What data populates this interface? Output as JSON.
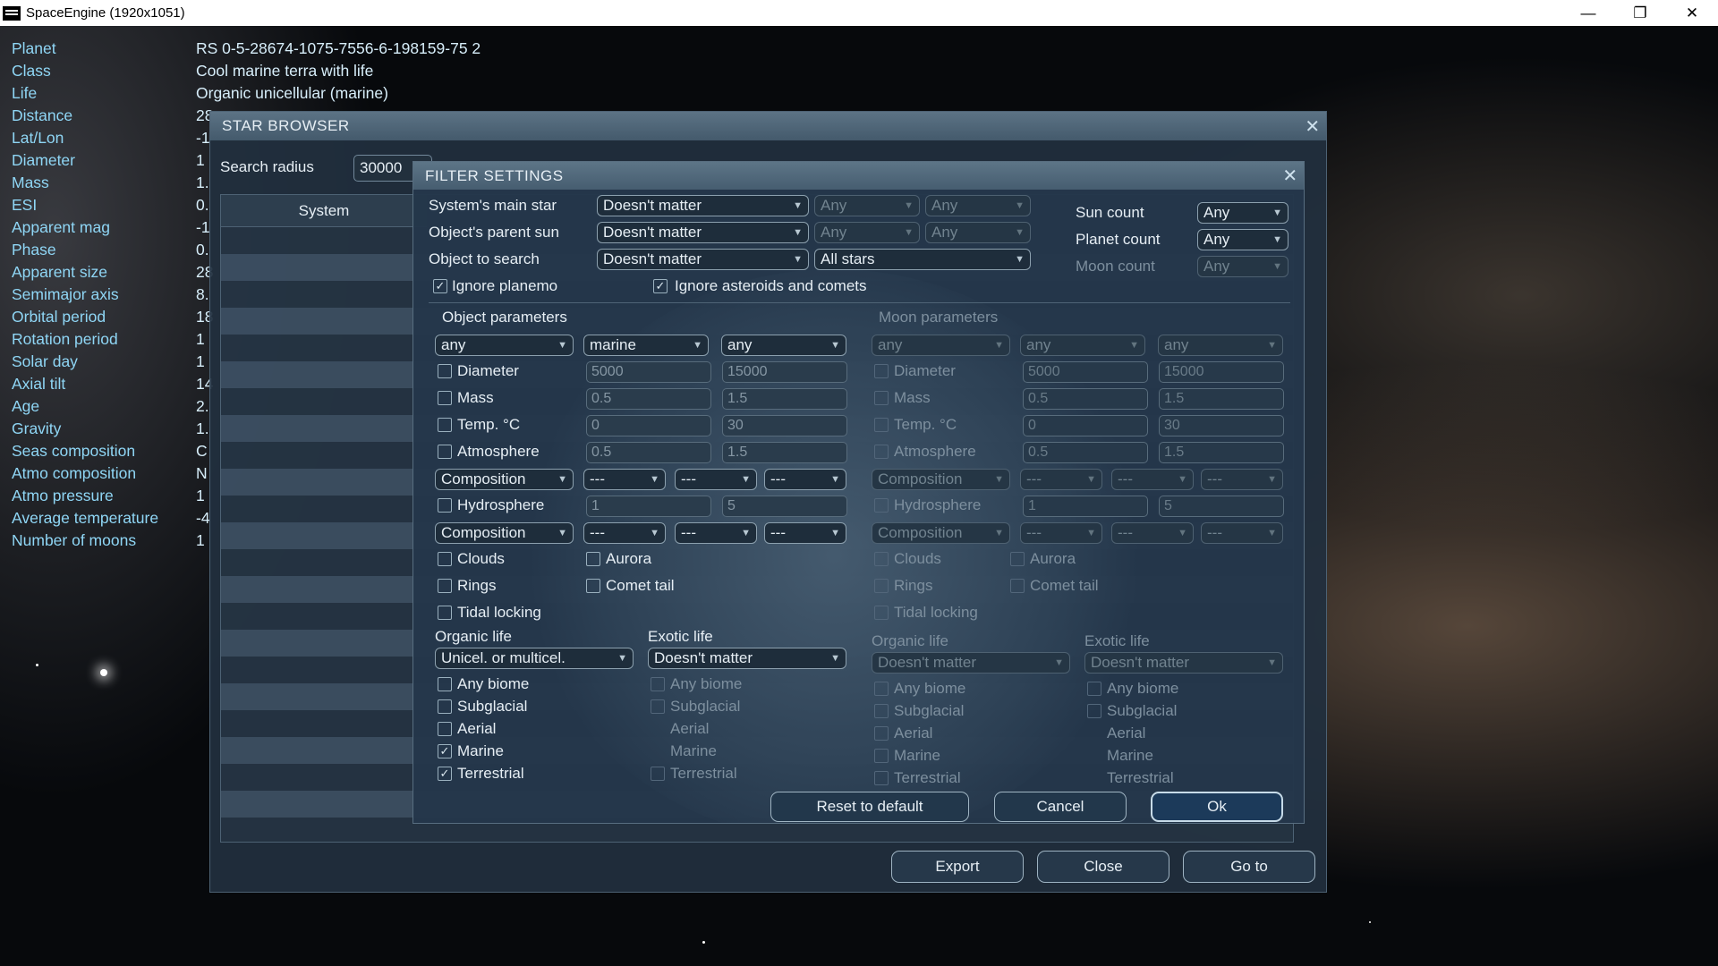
{
  "window": {
    "title": "SpaceEngine (1920x1051)",
    "min": "—",
    "max": "❐",
    "close": "✕"
  },
  "info": [
    [
      "Planet",
      "RS 0-5-28674-1075-7556-6-198159-75 2"
    ],
    [
      "Class",
      "Cool marine terra with life"
    ],
    [
      "Life",
      "Organic unicellular (marine)"
    ],
    [
      "Distance",
      "28"
    ],
    [
      "Lat/Lon",
      "-1"
    ],
    [
      "Diameter",
      "1"
    ],
    [
      "Mass",
      "1."
    ],
    [
      "ESI",
      "0."
    ],
    [
      "Apparent mag",
      "-1"
    ],
    [
      "Phase",
      "0."
    ],
    [
      "Apparent size",
      "28"
    ],
    [
      "Semimajor axis",
      "8."
    ],
    [
      "Orbital period",
      "18"
    ],
    [
      "Rotation period",
      "1"
    ],
    [
      "Solar day",
      "1"
    ],
    [
      "Axial tilt",
      "14"
    ],
    [
      "Age",
      "2."
    ],
    [
      "Gravity",
      "1."
    ],
    [
      "Seas composition",
      "C"
    ],
    [
      "Atmo composition",
      "N"
    ],
    [
      "Atmo pressure",
      "1"
    ],
    [
      "Average temperature",
      "-4"
    ],
    [
      "Number of moons",
      "1"
    ]
  ],
  "star_browser": {
    "title": "STAR BROWSER",
    "close": "✕",
    "radius_label": "Search radius",
    "radius_value": "30000",
    "col_system": "System",
    "export": "Export",
    "close_btn": "Close",
    "goto": "Go to"
  },
  "filter": {
    "title": "FILTER SETTINGS",
    "close": "✕",
    "main_star_label": "System's main star",
    "main_star": "Doesn't matter",
    "any": "Any",
    "parent_sun_label": "Object's parent sun",
    "parent_sun": "Doesn't matter",
    "search_label": "Object to search",
    "search": "Doesn't matter",
    "all_stars": "All stars",
    "sun_count": "Sun count",
    "planet_count": "Planet count",
    "moon_count": "Moon count",
    "ignore_planemo": "Ignore planemo",
    "ignore_asteroids": "Ignore asteroids and comets",
    "obj_params": "Object parameters",
    "moon_params": "Moon parameters",
    "dd_any": "any",
    "dd_marine": "marine",
    "diameter": "Diameter",
    "mass": "Mass",
    "temp": "Temp. °C",
    "atmosphere": "Atmosphere",
    "hydrosphere": "Hydrosphere",
    "composition": "Composition",
    "dashes": "---",
    "v_dmin": "5000",
    "v_dmax": "15000",
    "v_mmin": "0.5",
    "v_mmax": "1.5",
    "v_tmin": "0",
    "v_tmax": "30",
    "v_amin": "0.5",
    "v_amax": "1.5",
    "v_hmin": "1",
    "v_hmax": "5",
    "clouds": "Clouds",
    "aurora": "Aurora",
    "rings": "Rings",
    "comet": "Comet tail",
    "tidal": "Tidal locking",
    "organic": "Organic life",
    "exotic": "Exotic life",
    "organic_val": "Unicel. or multicel.",
    "doesnt": "Doesn't matter",
    "any_biome": "Any biome",
    "subglacial": "Subglacial",
    "aerial": "Aerial",
    "marine": "Marine",
    "terrestrial": "Terrestrial",
    "reset": "Reset to default",
    "cancel": "Cancel",
    "ok": "Ok"
  }
}
